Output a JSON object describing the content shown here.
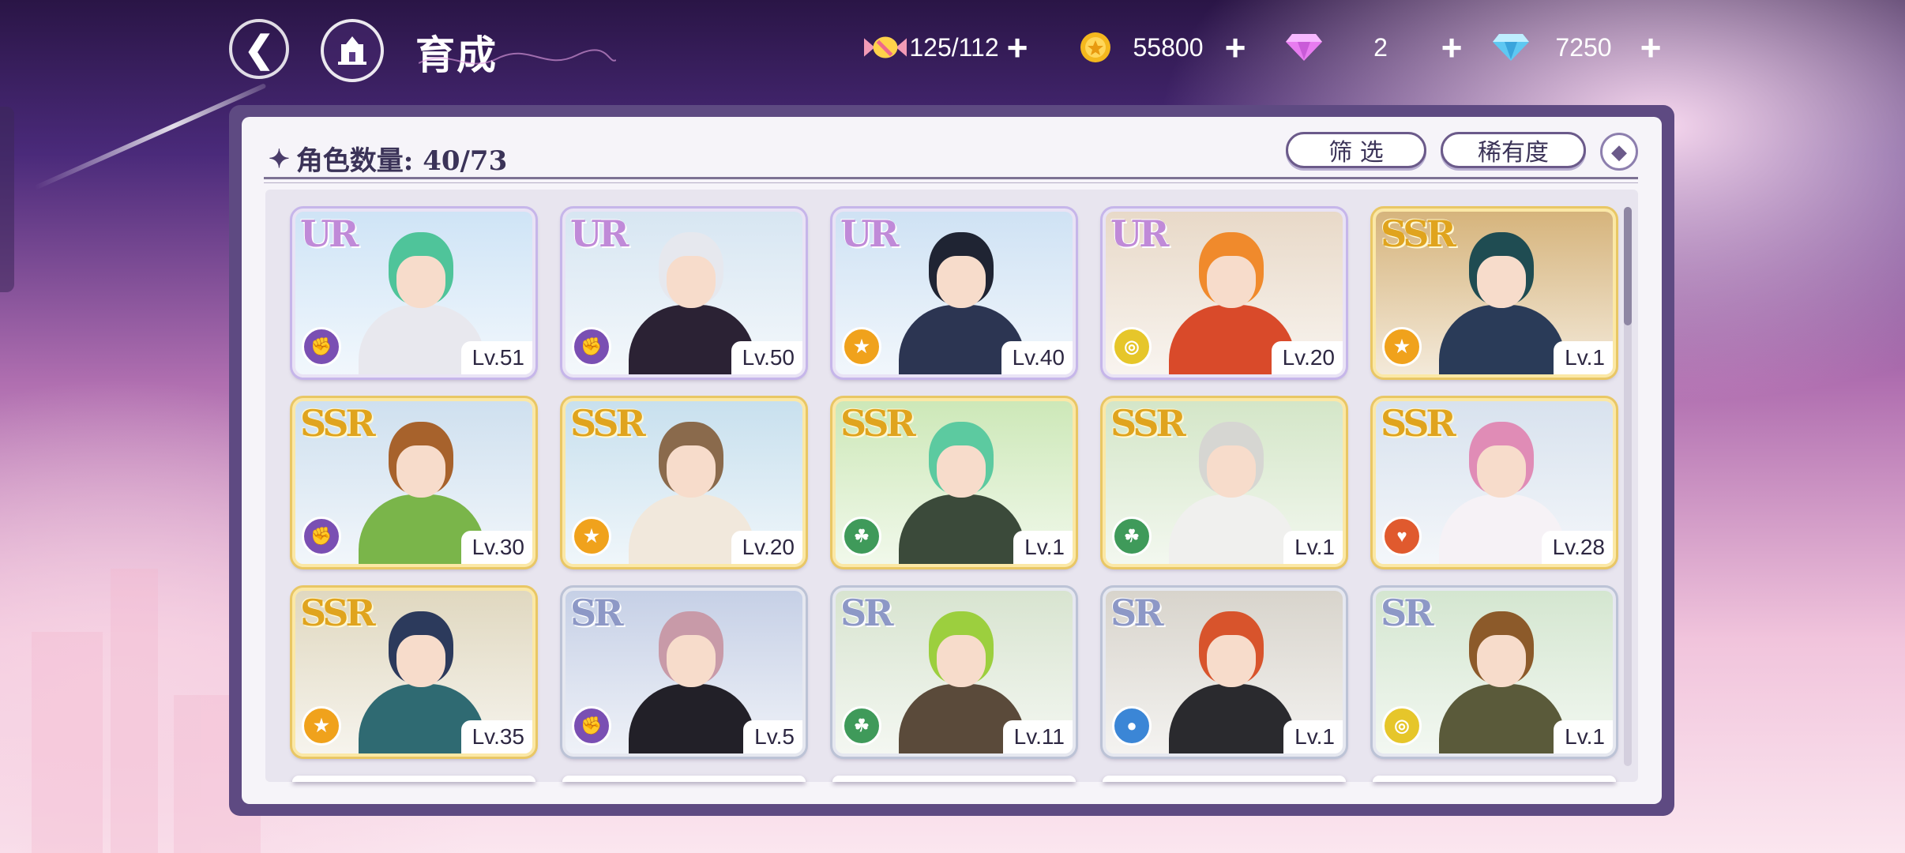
{
  "header": {
    "title": "育成",
    "resources": [
      {
        "icon": "candy-icon",
        "value": "125/112"
      },
      {
        "icon": "gold-coin-icon",
        "value": "55800"
      },
      {
        "icon": "pink-diamond-icon",
        "value": "2"
      },
      {
        "icon": "blue-diamond-icon",
        "value": "7250"
      }
    ]
  },
  "panel": {
    "count_label": "角色数量: 40/73",
    "filter_label": "筛 选",
    "rarity_label": "稀有度"
  },
  "colors": {
    "ur_text": "#c08ad8",
    "ssr_text": "#e0a41e",
    "sr_text": "#8d98c6",
    "element_purple": "#7a4fb3",
    "element_orange": "#f0a21c",
    "element_yellow": "#e6c62a",
    "element_green": "#3f9a5a",
    "element_red": "#e05a2e",
    "element_blue": "#3b86d6"
  },
  "cards": [
    {
      "rarity": "UR",
      "level": "Lv.51",
      "element": "purple",
      "hair": "#4fc49a",
      "outfit": "#e8e8ee",
      "bg": "#cfe4f6"
    },
    {
      "rarity": "UR",
      "level": "Lv.50",
      "element": "purple",
      "hair": "#e6e8ee",
      "outfit": "#2b2234",
      "bg": "#d7e6f2"
    },
    {
      "rarity": "UR",
      "level": "Lv.40",
      "element": "orange",
      "hair": "#1f2433",
      "outfit": "#2c3552",
      "bg": "#cfe2f4"
    },
    {
      "rarity": "UR",
      "level": "Lv.20",
      "element": "yellow",
      "hair": "#f08a2c",
      "outfit": "#d94a2a",
      "bg": "#e8d9c8"
    },
    {
      "rarity": "SSR",
      "level": "Lv.1",
      "element": "orange",
      "hair": "#1f4c52",
      "outfit": "#2a3b58",
      "bg": "#d6b47c"
    },
    {
      "rarity": "SSR",
      "level": "Lv.30",
      "element": "purple",
      "hair": "#a7622c",
      "outfit": "#7ab54a",
      "bg": "#cfe0ef"
    },
    {
      "rarity": "SSR",
      "level": "Lv.20",
      "element": "orange",
      "hair": "#8a6a4c",
      "outfit": "#f1e8dc",
      "bg": "#c8e0ee"
    },
    {
      "rarity": "SSR",
      "level": "Lv.1",
      "element": "green",
      "hair": "#5ccaa0",
      "outfit": "#3b4a3a",
      "bg": "#cde8b8"
    },
    {
      "rarity": "SSR",
      "level": "Lv.1",
      "element": "green",
      "hair": "#d6d6d2",
      "outfit": "#f0f0ee",
      "bg": "#d4e6c8"
    },
    {
      "rarity": "SSR",
      "level": "Lv.28",
      "element": "red",
      "hair": "#e08cb6",
      "outfit": "#f6f2f6",
      "bg": "#d8e2ee"
    },
    {
      "rarity": "SSR",
      "level": "Lv.35",
      "element": "orange",
      "hair": "#2c3a5c",
      "outfit": "#2f6a72",
      "bg": "#e0d8c0"
    },
    {
      "rarity": "SR",
      "level": "Lv.5",
      "element": "purple",
      "hair": "#c89aa8",
      "outfit": "#222028",
      "bg": "#c6d0e6"
    },
    {
      "rarity": "SR",
      "level": "Lv.11",
      "element": "green",
      "hair": "#9ccf3e",
      "outfit": "#5a4a3a",
      "bg": "#d8e4d0"
    },
    {
      "rarity": "SR",
      "level": "Lv.1",
      "element": "blue",
      "hair": "#d8542c",
      "outfit": "#2a2a2e",
      "bg": "#d8d4cc"
    },
    {
      "rarity": "SR",
      "level": "Lv.1",
      "element": "yellow",
      "hair": "#8c5a2a",
      "outfit": "#5a5a3a",
      "bg": "#d4e6d0"
    }
  ]
}
